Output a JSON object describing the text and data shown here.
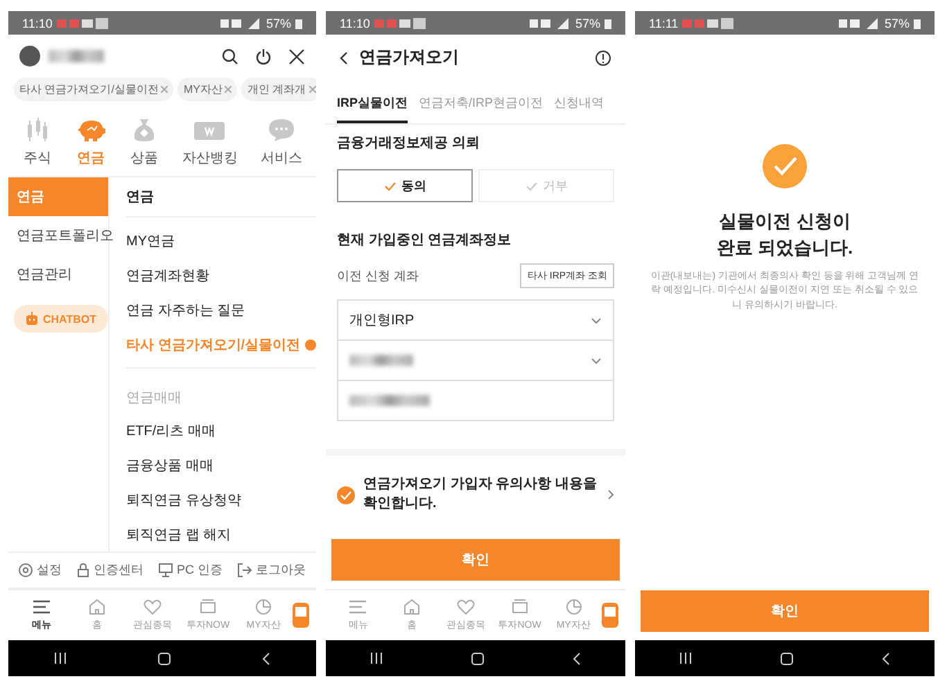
{
  "phones": [
    {
      "kind": "menu",
      "status_bar": {
        "time": "11:10",
        "battery": "57%"
      },
      "chips": [
        {
          "label": "타사 연금가져오기/실물이전"
        },
        {
          "label": "MY자산"
        },
        {
          "label": "개인 계좌개"
        }
      ],
      "categories": [
        {
          "kind": "chart",
          "label": "주식",
          "selected": false
        },
        {
          "kind": "piggy",
          "label": "연금",
          "selected": true
        },
        {
          "kind": "bag",
          "label": "상품",
          "selected": false
        },
        {
          "kind": "wallet",
          "label": "자산뱅킹",
          "selected": false
        },
        {
          "kind": "chat",
          "label": "서비스",
          "selected": false
        }
      ],
      "sidebar": [
        {
          "label": "연금",
          "selected": true
        },
        {
          "label": "연금포트폴리오",
          "selected": false
        },
        {
          "label": "연금관리",
          "selected": false
        }
      ],
      "chatbot": "CHATBOT",
      "menu_items": [
        {
          "kind": "header",
          "label": "연금"
        },
        {
          "kind": "item",
          "label": "MY연금",
          "selected": false,
          "badge": false
        },
        {
          "kind": "item",
          "label": "연금계좌현황",
          "selected": false,
          "badge": false
        },
        {
          "kind": "item",
          "label": "연금 자주하는 질문",
          "selected": false,
          "badge": false
        },
        {
          "kind": "item",
          "label": "타사 연금가져오기/실물이전",
          "selected": true,
          "badge": true
        },
        {
          "kind": "section",
          "label": "연금매매"
        },
        {
          "kind": "item",
          "label": "ETF/리츠 매매",
          "selected": false,
          "badge": false
        },
        {
          "kind": "item",
          "label": "금융상품 매매",
          "selected": false,
          "badge": false
        },
        {
          "kind": "item",
          "label": "퇴직연금 유상청약",
          "selected": false,
          "badge": false
        },
        {
          "kind": "item",
          "label": "퇴직연금 랩 해지",
          "selected": false,
          "badge": false
        }
      ],
      "footer_links": [
        {
          "kind": "settings",
          "label": "설정"
        },
        {
          "kind": "lock",
          "label": "인증센터"
        },
        {
          "kind": "pc",
          "label": "PC 인증"
        },
        {
          "kind": "logout",
          "label": "로그아웃"
        }
      ],
      "tab_bar": [
        {
          "kind": "menu",
          "label": "메뉴",
          "selected": true
        },
        {
          "kind": "home",
          "label": "홈",
          "selected": false
        },
        {
          "kind": "heart",
          "label": "관심종목",
          "selected": false
        },
        {
          "kind": "tv",
          "label": "투자NOW",
          "selected": false
        },
        {
          "kind": "pie",
          "label": "MY자산",
          "selected": false
        }
      ]
    },
    {
      "kind": "form",
      "status_bar": {
        "time": "11:10",
        "battery": "57%"
      },
      "title": "연금가져오기",
      "tabs": [
        {
          "label": "IRP실물이전",
          "selected": true
        },
        {
          "label": "연금저축/IRP현금이전",
          "selected": false
        },
        {
          "label": "신청내역",
          "selected": false
        }
      ],
      "consent": {
        "title": "금융거래정보제공 의뢰",
        "options": [
          {
            "label": "동의",
            "selected": true
          },
          {
            "label": "거부",
            "selected": false
          }
        ]
      },
      "account": {
        "title": "현재 가입중인 연금계좌정보",
        "label": "이전 신청 계좌",
        "lookup_button": "타사 IRP계좌 조회",
        "type_select": "개인형IRP"
      },
      "agreement": {
        "text": "연금가져오기 가입자 유의사항 내용을 확인합니다.",
        "checked": true
      },
      "confirm_button": "확인",
      "tab_bar": [
        {
          "kind": "menu",
          "label": "메뉴",
          "selected": false
        },
        {
          "kind": "home",
          "label": "홈",
          "selected": false
        },
        {
          "kind": "heart",
          "label": "관심종목",
          "selected": false
        },
        {
          "kind": "tv",
          "label": "투자NOW",
          "selected": false
        },
        {
          "kind": "pie",
          "label": "MY자산",
          "selected": false
        }
      ]
    },
    {
      "kind": "done",
      "status_bar": {
        "time": "11:11",
        "battery": "57%"
      },
      "title": "실물이전 신청이\n완료 되었습니다.",
      "message": "이관(내보내는) 기관에서 최종의사 확인 등을 위해 고객님께 연락 예정입니다. 미수신시 실물이전이 지연 또는 취소될 수 있으니 유의하시기 바랍니다.",
      "confirm_button": "확인"
    }
  ]
}
